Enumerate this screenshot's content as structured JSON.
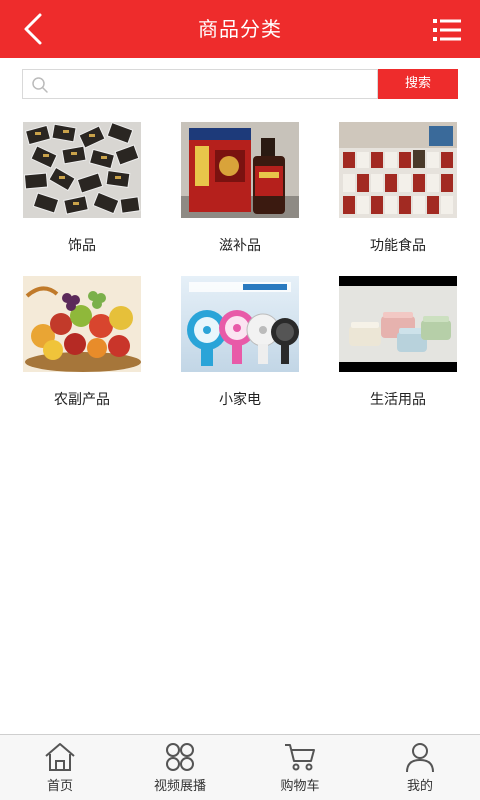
{
  "header": {
    "title": "商品分类",
    "back_icon": "chevron-left-icon",
    "menu_icon": "list-menu-icon",
    "bg_color": "#ee2c2c"
  },
  "search": {
    "placeholder": "",
    "value": "",
    "button_label": "搜索",
    "icon": "search-icon"
  },
  "categories": [
    {
      "label": "饰品",
      "image": "pile of small black packets"
    },
    {
      "label": "滋补品",
      "image": "red box and bottle"
    },
    {
      "label": "功能食品",
      "image": "shelves of canned goods"
    },
    {
      "label": "农副产品",
      "image": "basket of fruit"
    },
    {
      "label": "小家电",
      "image": "colorful desk fans"
    },
    {
      "label": "生活用品",
      "image": "pastel plastic boxes"
    }
  ],
  "tabbar": {
    "items": [
      {
        "label": "首页",
        "icon": "home-icon"
      },
      {
        "label": "视频展播",
        "icon": "grid-icon"
      },
      {
        "label": "购物车",
        "icon": "cart-icon"
      },
      {
        "label": "我的",
        "icon": "user-icon"
      }
    ]
  }
}
